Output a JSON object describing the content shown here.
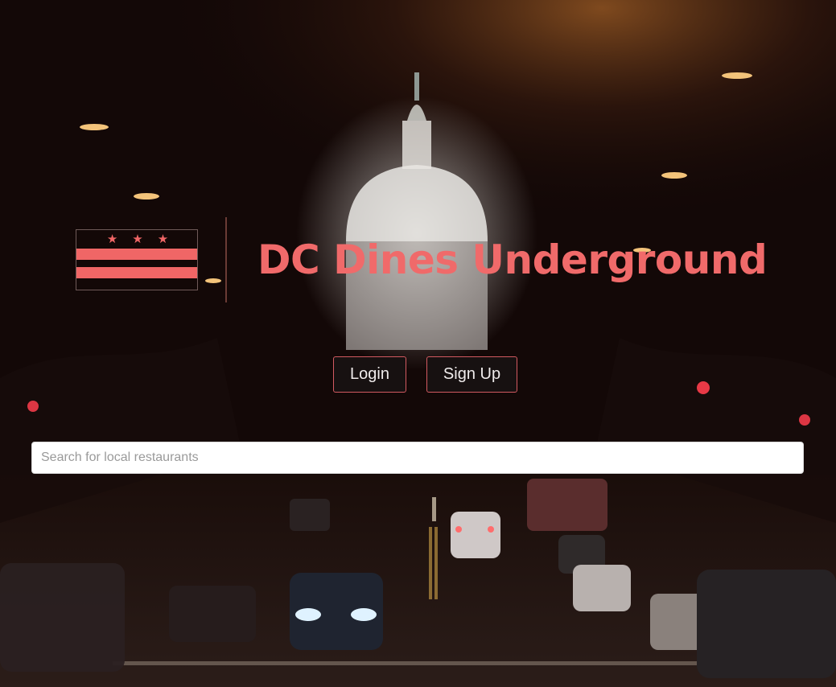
{
  "hero": {
    "background_scene": "night street with Capitol dome",
    "title": "DC Dines Underground",
    "title_color": "#f06a6a"
  },
  "logo": {
    "flag_icon": "dc-flag-icon",
    "stars": [
      "★",
      "★",
      "★"
    ],
    "flag_color": "#f06666"
  },
  "auth": {
    "login_label": "Login",
    "signup_label": "Sign Up",
    "button_border_color": "#d35a61"
  },
  "search": {
    "placeholder": "Search for local restaurants",
    "value": ""
  }
}
